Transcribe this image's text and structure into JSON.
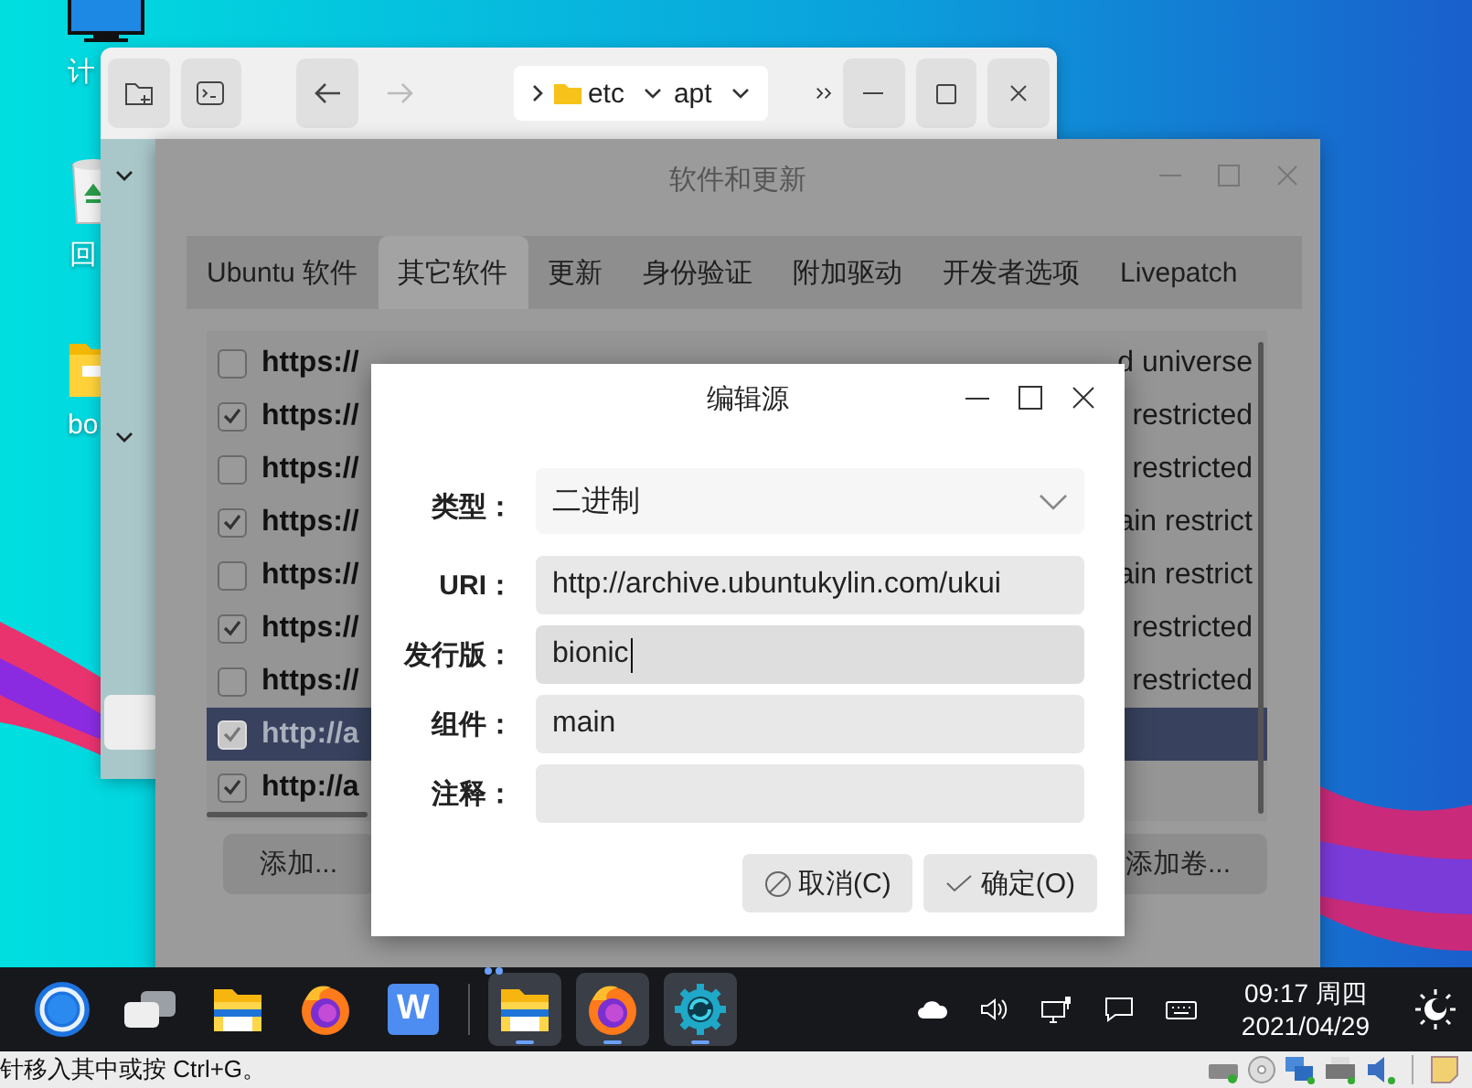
{
  "desktop_icons": [
    {
      "kind": "computer",
      "label": "计"
    },
    {
      "kind": "trash",
      "label": "回"
    },
    {
      "kind": "folder",
      "label": "bo"
    }
  ],
  "file_manager": {
    "path": [
      "etc",
      "apt"
    ]
  },
  "software_window": {
    "title": "软件和更新",
    "tabs": [
      {
        "label": "Ubuntu 软件",
        "selected": false
      },
      {
        "label": "其它软件",
        "selected": true
      },
      {
        "label": "更新",
        "selected": false
      },
      {
        "label": "身份验证",
        "selected": false
      },
      {
        "label": "附加驱动",
        "selected": false
      },
      {
        "label": "开发者选项",
        "selected": false
      },
      {
        "label": "Livepatch",
        "selected": false
      }
    ],
    "sources": [
      {
        "checked": false,
        "selected": false,
        "start": "https://",
        "end": "d universe"
      },
      {
        "checked": true,
        "selected": false,
        "start": "https://",
        "end": "restricted"
      },
      {
        "checked": false,
        "selected": false,
        "start": "https://",
        "end": "restricted"
      },
      {
        "checked": true,
        "selected": false,
        "start": "https://",
        "end": "ain restrict"
      },
      {
        "checked": false,
        "selected": false,
        "start": "https://",
        "end": "ain restrict"
      },
      {
        "checked": true,
        "selected": false,
        "start": "https://",
        "end": "restricted"
      },
      {
        "checked": false,
        "selected": false,
        "start": "https://",
        "end": "restricted"
      },
      {
        "checked": true,
        "selected": true,
        "start": "http://a"
      },
      {
        "checked": true,
        "selected": false,
        "start": "http://a"
      }
    ],
    "buttons": [
      "添加...",
      "添加卷..."
    ]
  },
  "dialog": {
    "title": "编辑源",
    "fields": [
      {
        "label": "类型：",
        "kind": "combo",
        "value": "二进制"
      },
      {
        "label": "URI：",
        "kind": "text",
        "value": "http://archive.ubuntukylin.com/ukui",
        "focused": false
      },
      {
        "label": "发行版：",
        "kind": "text",
        "value": "bionic",
        "focused": true
      },
      {
        "label": "组件：",
        "kind": "text",
        "value": "main",
        "focused": false
      },
      {
        "label": "注释：",
        "kind": "text",
        "focused": false
      }
    ],
    "buttons": [
      {
        "kind": "cancel",
        "label": "取消(C)"
      },
      {
        "kind": "ok",
        "label": "确定(O)"
      }
    ]
  },
  "taskbar": {
    "apps": [
      {
        "kind": "start",
        "running": false
      },
      {
        "kind": "multitask",
        "running": false
      },
      {
        "kind": "files",
        "running": false
      },
      {
        "kind": "firefox",
        "running": false
      },
      {
        "kind": "wps",
        "label": "W",
        "running": false
      },
      {
        "kind": "files",
        "running": true
      },
      {
        "kind": "firefox",
        "running": true
      },
      {
        "kind": "settings",
        "running": true
      }
    ],
    "clock": {
      "time": "09:17 周四",
      "date": "2021/04/29"
    }
  },
  "status_bar": {
    "hint": "针移入其中或按 Ctrl+G。"
  }
}
